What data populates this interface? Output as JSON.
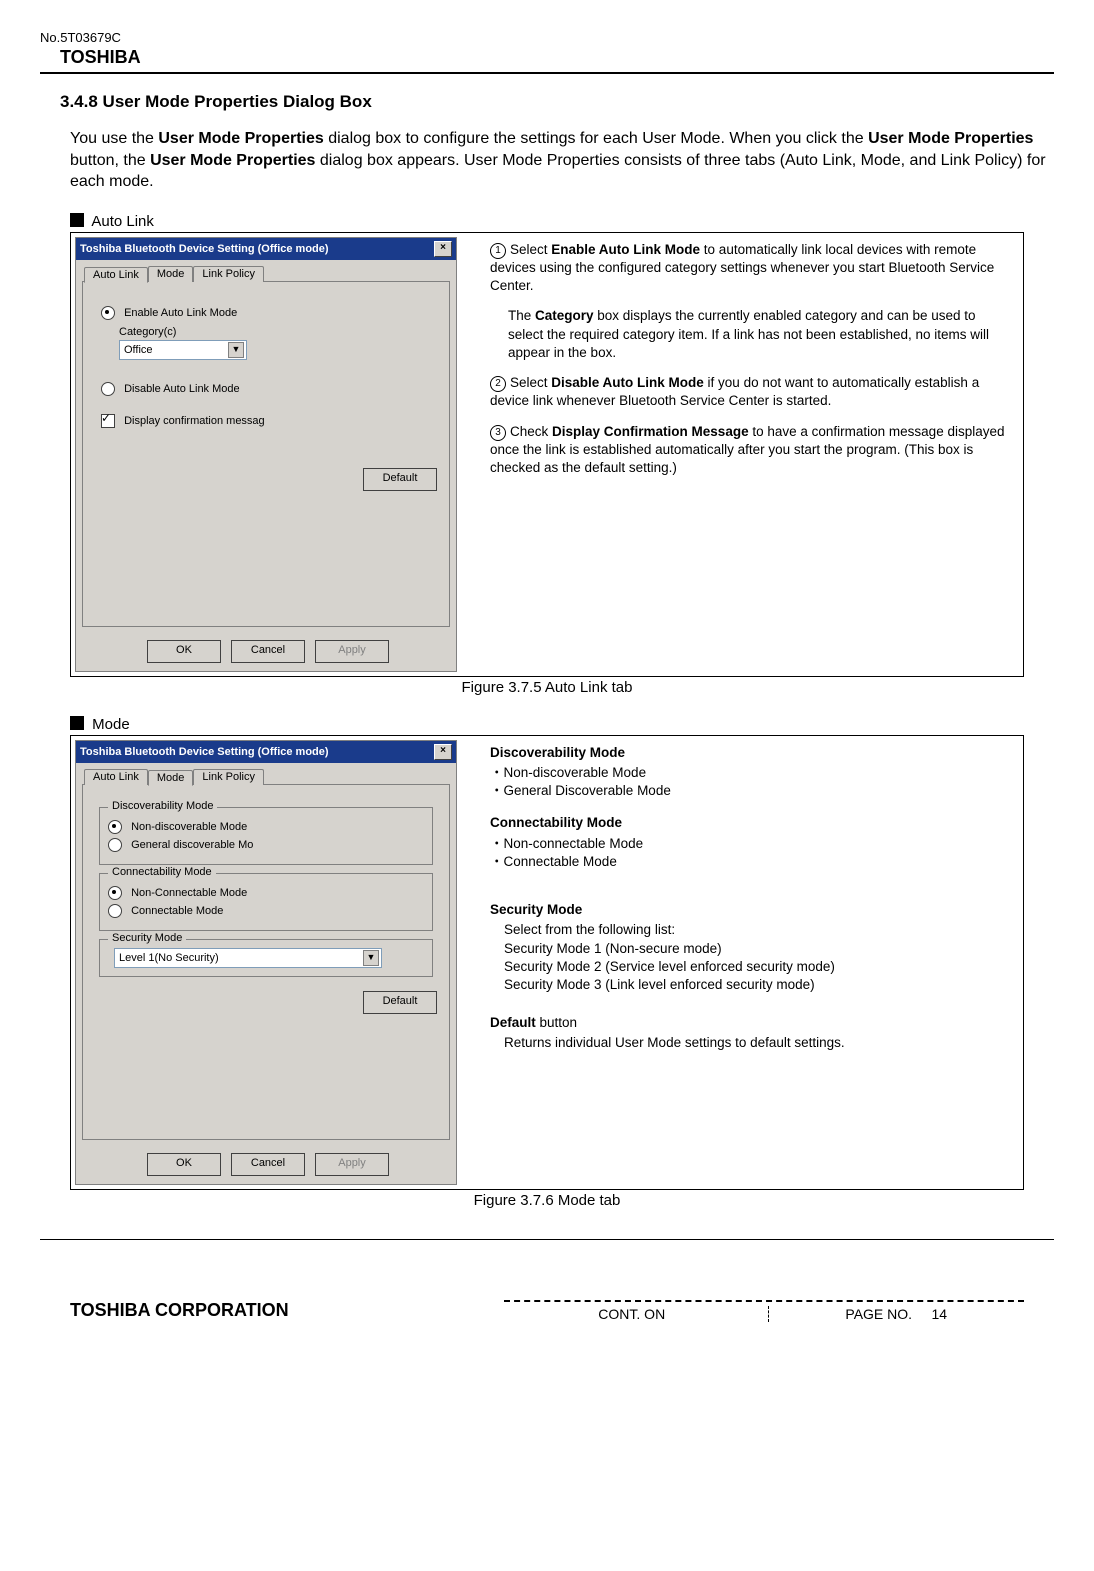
{
  "header": {
    "docNo": "No.5T03679C",
    "brand": "TOSHIBA"
  },
  "section": {
    "number": "3.4.8",
    "title": "User Mode Properties Dialog Box"
  },
  "intro": {
    "p1a": "You use the ",
    "bold1": "User Mode Properties",
    "p1b": " dialog box to configure the settings for each User Mode. When you click the ",
    "bold2": "User Mode Properties",
    "p1c": " button, the ",
    "bold3": "User Mode Properties",
    "p1d": " dialog box appears. User Mode Properties consists of three tabs (Auto Link, Mode, and Link Policy) for each mode."
  },
  "autolink": {
    "heading": "Auto Link",
    "dlgTitle": "Toshiba Bluetooth Device Setting (Office mode)",
    "tabs": [
      "Auto Link",
      "Mode",
      "Link Policy"
    ],
    "enable": "Enable Auto Link Mode",
    "categoryLabel": "Category(c)",
    "categoryValue": "Office",
    "disable": "Disable Auto Link Mode",
    "displayConfirm": "Display confirmation messag",
    "defaultBtn": "Default",
    "ok": "OK",
    "cancel": "Cancel",
    "apply": "Apply",
    "caption": "Figure 3.7.5 Auto Link tab",
    "desc": {
      "n1a": "Select ",
      "n1bold": "Enable Auto Link Mode",
      "n1b": " to automatically link local devices with remote devices using the configured category settings whenever you start Bluetooth Service Center.",
      "n1c_a": "The ",
      "n1c_bold": "Category",
      "n1c_b": " box displays the currently enabled category and can be used to select the required category item. If a link has not been established, no items will appear in the box.",
      "n2a": "Select ",
      "n2bold": "Disable Auto Link Mode",
      "n2b": " if you do not want to automatically establish a device link whenever Bluetooth Service Center is started.",
      "n3a": "Check ",
      "n3bold": "Display Confirmation Message",
      "n3b": " to have a confirmation message displayed once the link is established automatically after you start the program. (This box is checked as the default setting.)"
    }
  },
  "mode": {
    "heading": "Mode",
    "dlgTitle": "Toshiba Bluetooth Device Setting (Office mode)",
    "discoverLegend": "Discoverability Mode",
    "nonDisc": "Non-discoverable Mode",
    "genDisc": "General discoverable Mo",
    "connectLegend": "Connectability Mode",
    "nonConn": "Non-Connectable Mode",
    "conn": "Connectable Mode",
    "securityLegend": "Security Mode",
    "securityValue": "Level 1(No Security)",
    "defaultBtn": "Default",
    "ok": "OK",
    "cancel": "Cancel",
    "apply": "Apply",
    "caption": "Figure 3.7.6 Mode tab",
    "desc": {
      "discTitle": "Discoverability Mode",
      "disc1": "・Non-discoverable Mode",
      "disc2": "・General Discoverable Mode",
      "connTitle": "Connectability Mode",
      "conn1": "・Non-connectable Mode",
      "conn2": "・Connectable Mode",
      "secTitle": "Security Mode",
      "sec0": "Select from the following list:",
      "sec1": "Security Mode 1 (Non-secure mode)",
      "sec2": "Security Mode 2 (Service level enforced security mode)",
      "sec3": "Security Mode 3 (Link level enforced security mode)",
      "defTitle": "Default",
      "defSuffix": " button",
      "def1": "Returns individual User Mode settings to default settings."
    }
  },
  "footer": {
    "corp": "TOSHIBA CORPORATION",
    "contOn": "CONT. ON",
    "pageNoLabel": "PAGE NO.",
    "pageNo": "14"
  }
}
